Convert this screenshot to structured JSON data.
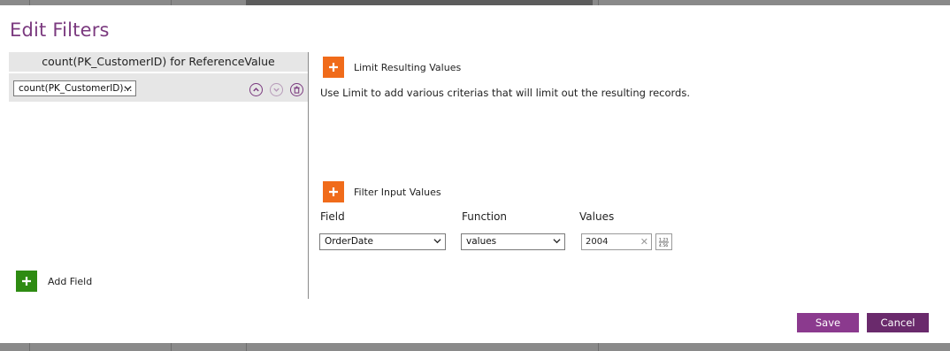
{
  "dialog": {
    "title": "Edit Filters"
  },
  "fields_panel": {
    "header": "count(PK_CustomerID) for ReferenceValue",
    "selected_field": "count(PK_CustomerID)...",
    "add_field_label": "Add Field"
  },
  "limit_section": {
    "title": "Limit Resulting Values",
    "description": "Use Limit to add various criterias that will limit out the resulting records."
  },
  "filter_section": {
    "title": "Filter Input Values",
    "columns": {
      "field": "Field",
      "function": "Function",
      "values": "Values"
    },
    "row": {
      "field": "OrderDate",
      "function": "values",
      "value": "2004"
    }
  },
  "footer": {
    "save_label": "Save",
    "cancel_label": "Cancel"
  },
  "colors": {
    "accent_purple": "#7b3a7f",
    "add_orange": "#f06b1a",
    "add_green": "#2e8b12",
    "save_button": "#8b3a8e",
    "cancel_button": "#6a2a6c"
  }
}
